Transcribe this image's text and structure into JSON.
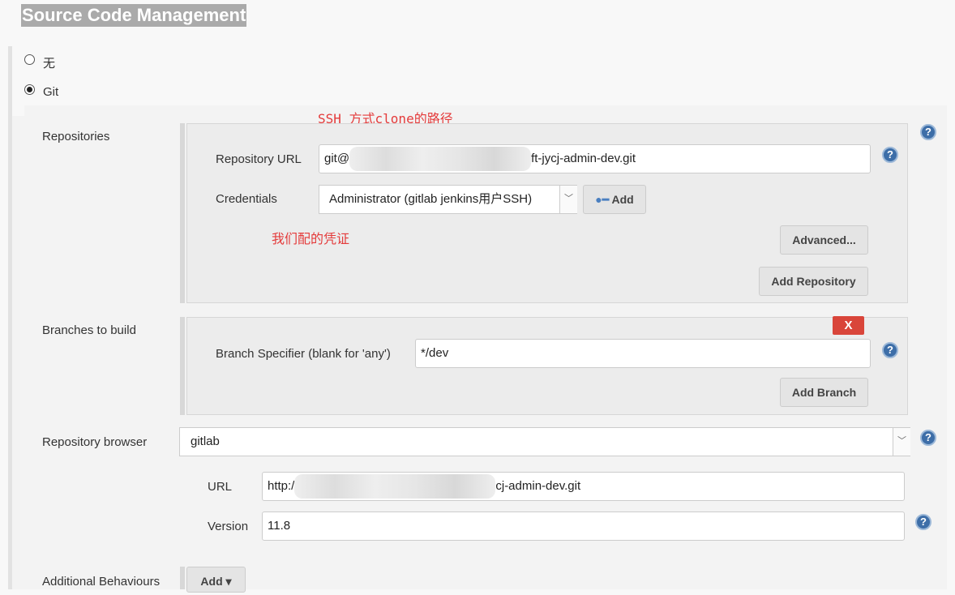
{
  "section_title": "Source Code Management",
  "scm_options": [
    {
      "label": "无",
      "selected": false
    },
    {
      "label": "Git",
      "selected": true
    }
  ],
  "annotations": {
    "ssh_note": "SSH 方式clone的路径",
    "cred_note": "我们配的凭证"
  },
  "repositories": {
    "label": "Repositories",
    "url_label": "Repository URL",
    "url_prefix": "git@",
    "url_suffix": "ft-jycj-admin-dev.git",
    "credentials_label": "Credentials",
    "credentials_value": "Administrator (gitlab jenkins用户SSH)",
    "add_label": "Add",
    "advanced_label": "Advanced...",
    "add_repository_label": "Add Repository"
  },
  "branches": {
    "label": "Branches to build",
    "delete_label": "X",
    "specifier_label": "Branch Specifier (blank for 'any')",
    "specifier_value": "*/dev",
    "add_branch_label": "Add Branch"
  },
  "browser": {
    "label": "Repository browser",
    "value": "gitlab",
    "url_label": "URL",
    "url_prefix": "http:/",
    "url_suffix": "cj-admin-dev.git",
    "version_label": "Version",
    "version_value": "11.8"
  },
  "additional": {
    "label": "Additional Behaviours",
    "add_label": "Add"
  },
  "help_icon": "?",
  "colors": {
    "help": "#3d6ea8",
    "delete": "#d9453a",
    "annotation": "#e43b3b"
  }
}
